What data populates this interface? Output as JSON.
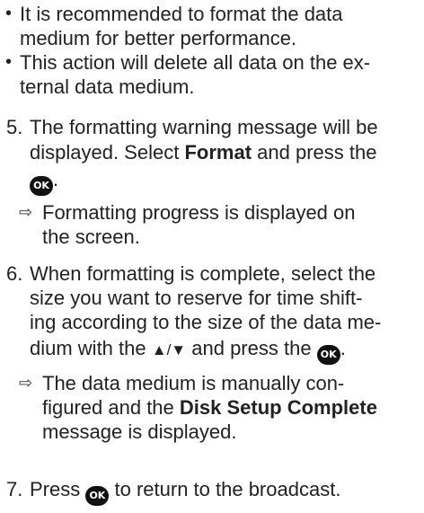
{
  "bullets": {
    "b1_l1": "It is recommended to format the data",
    "b1_l2": "medium for better performance.",
    "b2_l1": "This action will delete all data on the ex-",
    "b2_l2": "ternal data medium.",
    "dot": "•"
  },
  "steps": {
    "s5": {
      "num": "5.",
      "l1": "The formatting warning message will be",
      "l2_pre": "displayed. Select",
      "l2_bold": "Format",
      "l2_post": "and press the",
      "l3_post": "."
    },
    "r5": {
      "l1": "Formatting progress is displayed on",
      "l2": "the screen."
    },
    "s6": {
      "num": "6.",
      "l1": "When formatting is complete, select the",
      "l2": "size you want to reserve for time shift-",
      "l3": "ing according to the size of the data me-",
      "l4_pre": "dium with the",
      "l4_arrows": "▲/▼",
      "l4_post": "and press the",
      "l4_end": "."
    },
    "r6": {
      "l1": "The data medium is manually con-",
      "l2_pre": "figured and the",
      "l2_bold": "Disk Setup Complete",
      "l3": "message is displayed."
    },
    "s7": {
      "num": "7.",
      "pre": "Press",
      "post": "to return to the broadcast."
    }
  },
  "icons": {
    "ok_button": "OK",
    "result_arrow": "⇨"
  },
  "colors": {
    "text": "#222222",
    "ok_button_bg": "#111111"
  }
}
